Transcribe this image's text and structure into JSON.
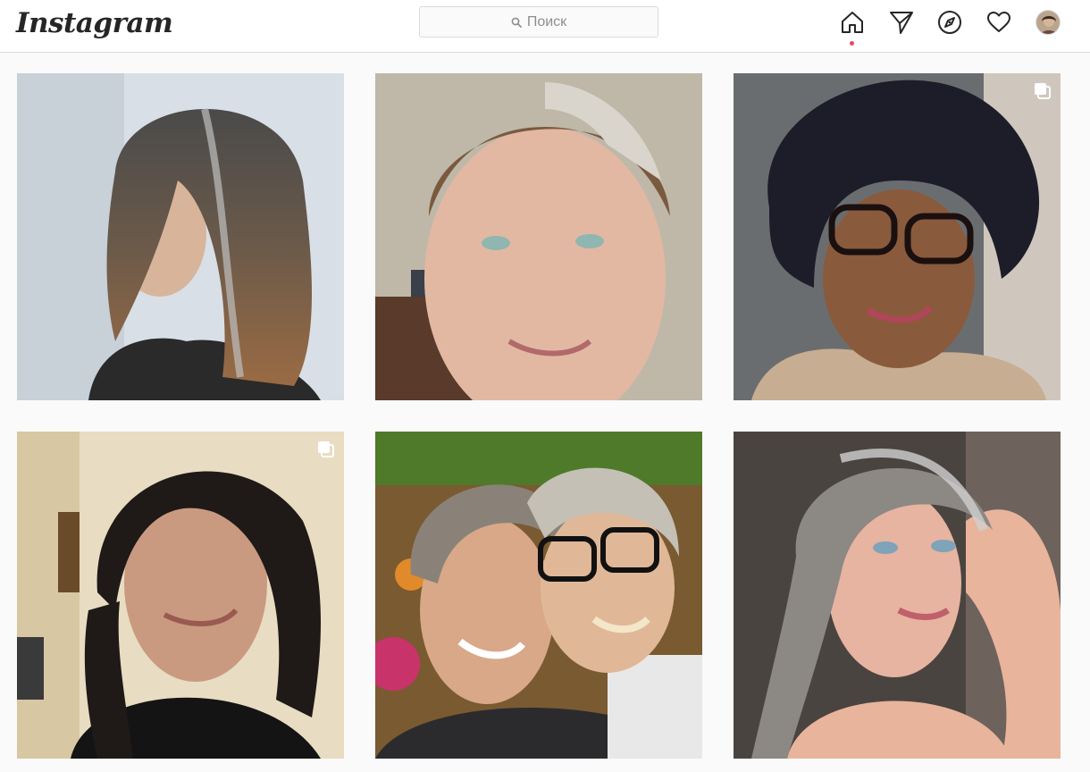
{
  "header": {
    "logo_text": "Instagram",
    "search": {
      "placeholder": "Поиск",
      "icon": "search-icon"
    },
    "nav": [
      {
        "name": "home",
        "icon": "home-icon",
        "active": true
      },
      {
        "name": "direct",
        "icon": "paper-plane-icon"
      },
      {
        "name": "explore",
        "icon": "compass-icon"
      },
      {
        "name": "activity",
        "icon": "heart-icon"
      },
      {
        "name": "profile",
        "icon": "avatar"
      }
    ],
    "notification_dot_color": "#ed4956"
  },
  "grid": {
    "posts": [
      {
        "id": "post-1",
        "multi": false
      },
      {
        "id": "post-2",
        "multi": false
      },
      {
        "id": "post-3",
        "multi": true,
        "badge_icon": "carousel-icon"
      },
      {
        "id": "post-4",
        "multi": true,
        "badge_icon": "carousel-icon"
      },
      {
        "id": "post-5",
        "multi": false
      },
      {
        "id": "post-6",
        "multi": false
      }
    ]
  },
  "colors": {
    "background": "#fafafa",
    "header_border": "#dbdbdb",
    "text": "#262626",
    "muted": "#8e8e8e"
  }
}
